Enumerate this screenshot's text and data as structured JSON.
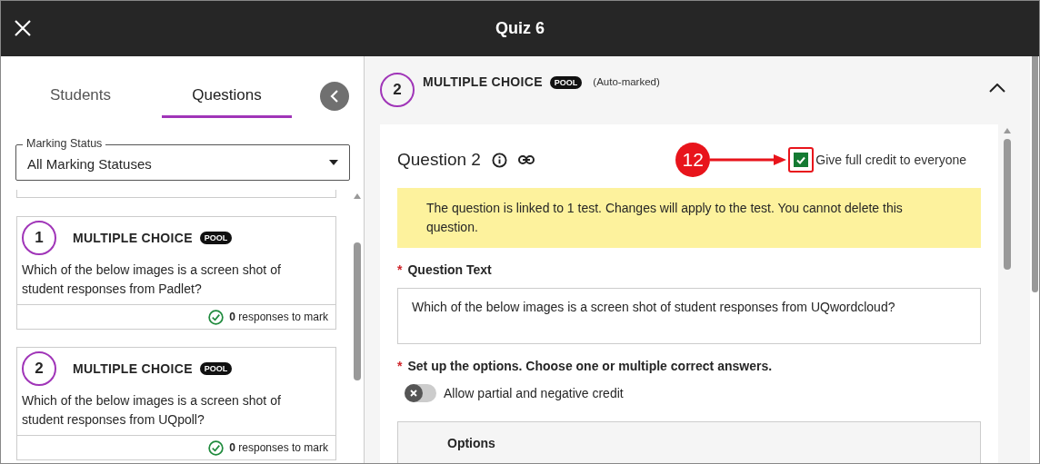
{
  "window": {
    "title": "Quiz 6"
  },
  "tabs": [
    {
      "label": "Students",
      "selected": false
    },
    {
      "label": "Questions",
      "selected": true
    }
  ],
  "filter": {
    "label": "Marking Status",
    "value": "All Marking Statuses"
  },
  "question_list": [
    {
      "number": "1",
      "type": "MULTIPLE CHOICE",
      "badge": "POOL",
      "text": "Which of the below images is a screen shot of student responses from Padlet?",
      "count": "0",
      "count_label": "responses to mark"
    },
    {
      "number": "2",
      "type": "MULTIPLE CHOICE",
      "badge": "POOL",
      "text": "Which of the below images is a screen shot of student responses from UQpoll?",
      "count": "0",
      "count_label": "responses to mark"
    }
  ],
  "detail": {
    "number": "2",
    "type": "MULTIPLE CHOICE",
    "badge": "POOL",
    "note": "(Auto-marked)",
    "expanded": true,
    "title": "Question 2",
    "full_credit": {
      "label": "Give full credit to everyone",
      "checked": true
    },
    "callout": "12",
    "banner": "The question is linked to 1 test. Changes will apply to the test. You cannot delete this question.",
    "fields": [
      {
        "label": "Question Text",
        "required_mark": "*"
      }
    ],
    "question_text": "Which of the below images is a screen shot of student responses from UQwordcloud?",
    "options_label": "Set up the options. Choose one or multiple correct answers.",
    "options_required_mark": "*",
    "partial_credit": {
      "label": "Allow partial and negative credit",
      "on": false
    },
    "options_heading": "Options"
  }
}
